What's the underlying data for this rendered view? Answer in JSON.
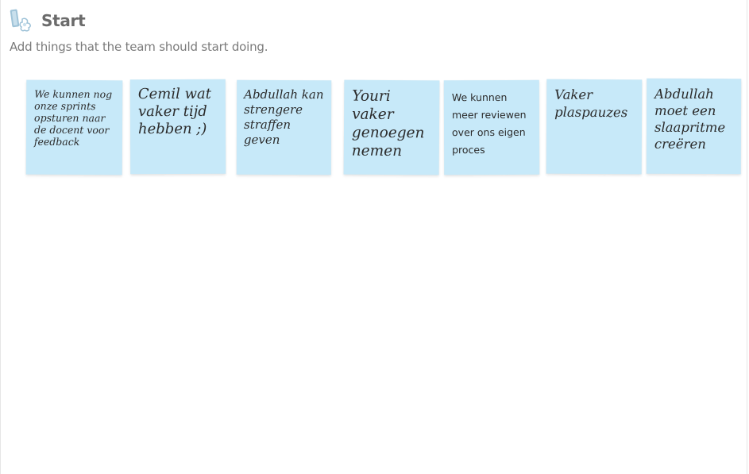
{
  "section": {
    "title": "Start",
    "description": "Add things that the team should start doing.",
    "icon": "broom-icon"
  },
  "notes": [
    {
      "text": "We kunnen nog onze sprints opsturen naar de docent voor feedback"
    },
    {
      "text": "Cemil wat vaker tijd hebben ;)"
    },
    {
      "text": "Abdullah kan strengere straffen geven"
    },
    {
      "text": "Youri vaker genoegen nemen"
    },
    {
      "text": "We kunnen meer reviewen over ons eigen proces"
    },
    {
      "text": "Vaker plaspauzes"
    },
    {
      "text": "Abdullah moet een slaapritme creëren"
    }
  ],
  "colors": {
    "note_background": "#c7e9f9",
    "title": "#6b6b6b",
    "subtitle": "#7b7b7b"
  }
}
